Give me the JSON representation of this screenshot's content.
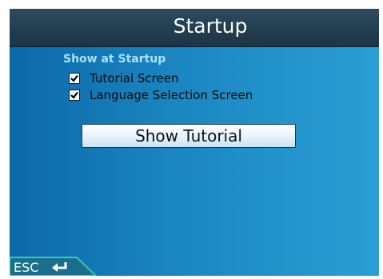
{
  "header": {
    "title": "Startup"
  },
  "startup": {
    "section_heading": "Show at Startup",
    "options": [
      {
        "label": "Tutorial Screen",
        "checked": true
      },
      {
        "label": "Language Selection Screen",
        "checked": true
      }
    ],
    "show_tutorial_label": "Show Tutorial"
  },
  "footer": {
    "esc_label": "ESC",
    "esc_icon": "return-arrow-icon"
  },
  "colors": {
    "background_left": "#0c68a8",
    "background_right": "#2a9fd4",
    "titlebar": "#1c3446",
    "section_heading": "#a8e2ff",
    "esc_tab": "#19a9a3"
  }
}
